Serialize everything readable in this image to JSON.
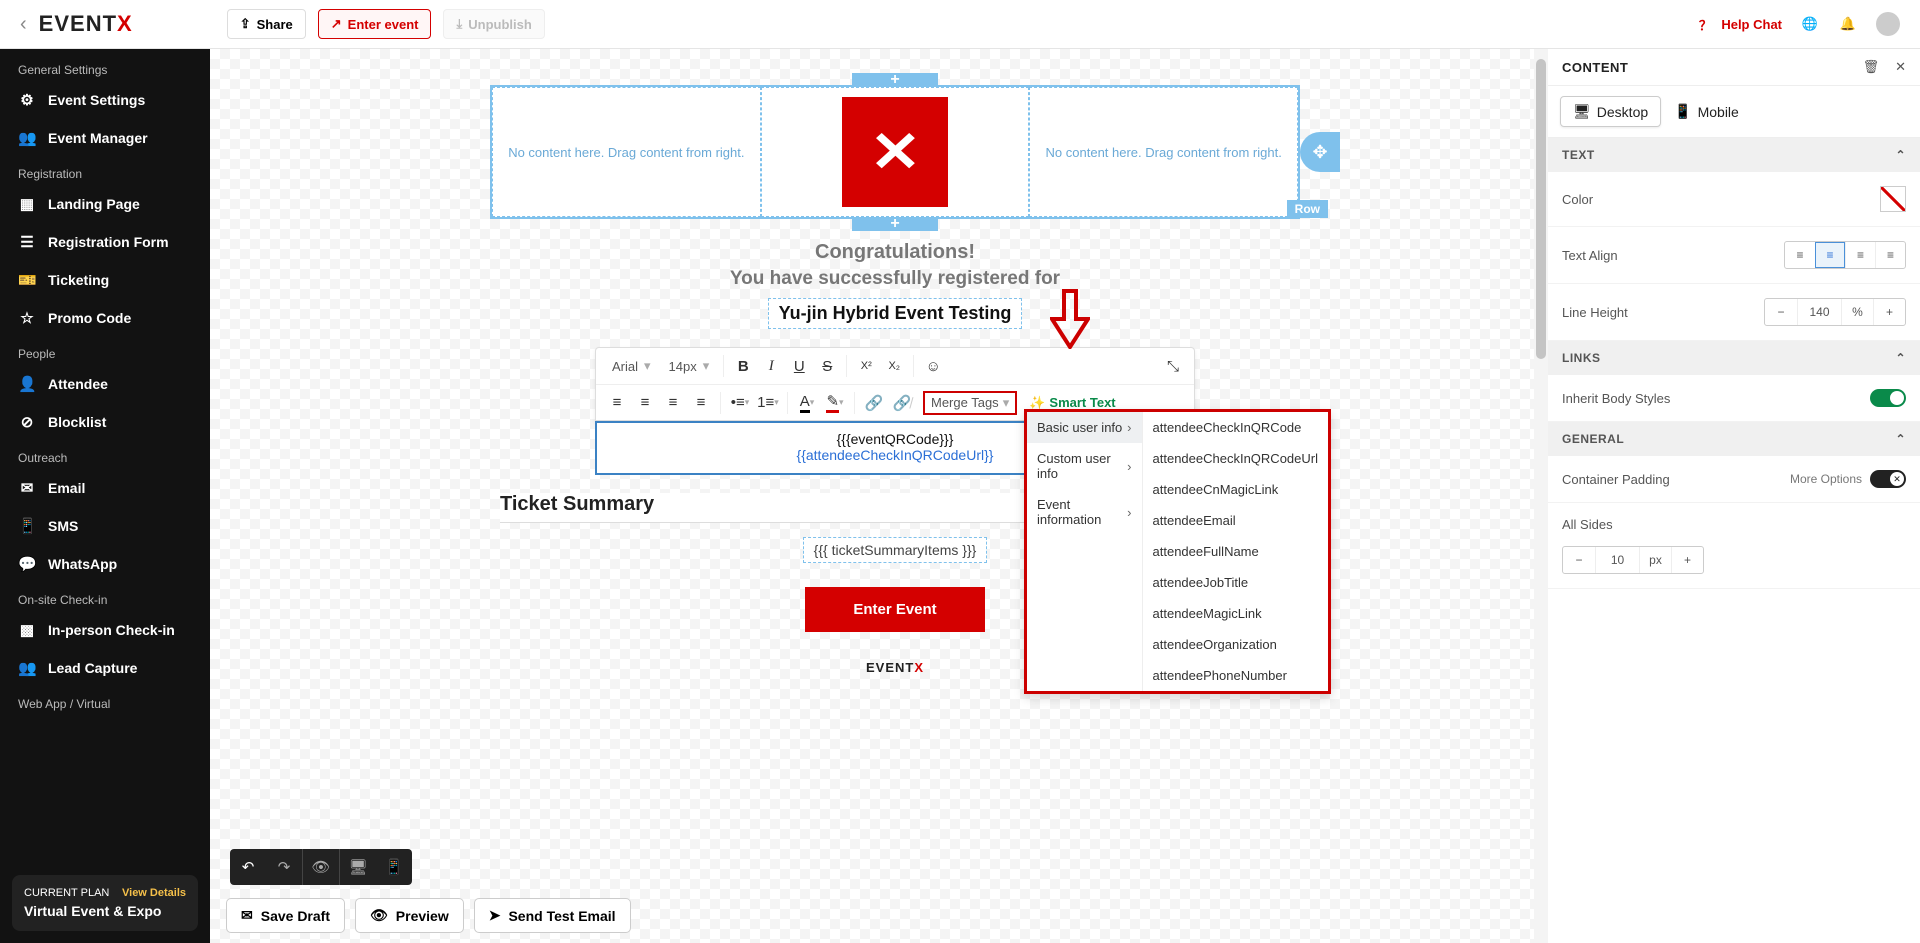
{
  "topbar": {
    "brand_prefix": "EVENT",
    "brand_suffix": "X",
    "share": "Share",
    "enter_event": "Enter event",
    "unpublish": "Unpublish",
    "help_chat": "Help Chat"
  },
  "sidebar": {
    "groups": {
      "g1": "General Settings",
      "g2": "Registration",
      "g3": "People",
      "g4": "Outreach",
      "g5": "On-site Check-in",
      "g6": "Web App / Virtual"
    },
    "items": {
      "event_settings": "Event Settings",
      "event_manager": "Event Manager",
      "landing_page": "Landing Page",
      "registration_form": "Registration Form",
      "ticketing": "Ticketing",
      "promo_code": "Promo Code",
      "attendee": "Attendee",
      "blocklist": "Blocklist",
      "email": "Email",
      "sms": "SMS",
      "whatsapp": "WhatsApp",
      "in_person_checkin": "In-person Check-in",
      "lead_capture": "Lead Capture"
    },
    "plan": {
      "label": "CURRENT PLAN",
      "view": "View Details",
      "name": "Virtual Event & Expo"
    }
  },
  "canvas": {
    "placeholder": "No content here. Drag content from right.",
    "row_label": "Row",
    "congrats": "Congratulations!",
    "subtitle": "You have successfully registered for",
    "event_name": "Yu-jin Hybrid Event Testing",
    "qr_line": "{{{eventQRCode}}}",
    "url_line": "{{attendeeCheckInQRCodeUrl}}",
    "ticket_summary": "Ticket Summary",
    "ticket_items": "{{{ ticketSummaryItems }}}",
    "enter_event": "Enter Event",
    "footer_prefix": "EVENT",
    "footer_suffix": "X"
  },
  "toolbar": {
    "font": "Arial",
    "size": "14px",
    "merge_tags": "Merge Tags",
    "smart_text": "Smart Text"
  },
  "merge_menu": {
    "col1": {
      "basic": "Basic user info",
      "custom": "Custom user info",
      "event_info": "Event information"
    },
    "col2": [
      "attendeeCheckInQRCode",
      "attendeeCheckInQRCodeUrl",
      "attendeeCnMagicLink",
      "attendeeEmail",
      "attendeeFullName",
      "attendeeJobTitle",
      "attendeeMagicLink",
      "attendeeOrganization",
      "attendeePhoneNumber"
    ]
  },
  "footer_actions": {
    "save_draft": "Save Draft",
    "preview": "Preview",
    "send_test": "Send Test Email"
  },
  "props": {
    "title": "CONTENT",
    "desktop": "Desktop",
    "mobile": "Mobile",
    "text": "TEXT",
    "color": "Color",
    "text_align": "Text Align",
    "line_height": "Line Height",
    "line_height_val": "140",
    "line_height_unit": "%",
    "links": "LINKS",
    "inherit": "Inherit Body Styles",
    "general": "GENERAL",
    "container_padding": "Container Padding",
    "more_options": "More Options",
    "all_sides": "All Sides",
    "all_sides_val": "10",
    "all_sides_unit": "px"
  }
}
